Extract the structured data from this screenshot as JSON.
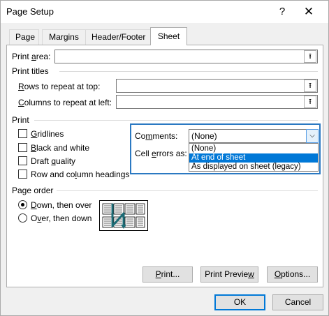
{
  "window": {
    "title": "Page Setup",
    "help_glyph": "?",
    "close_glyph": "✕"
  },
  "tabs": [
    {
      "label": "Page"
    },
    {
      "label": "Margins"
    },
    {
      "label": "Header/Footer"
    },
    {
      "label": "Sheet"
    }
  ],
  "print_area": {
    "pre": "Print ",
    "accel": "a",
    "post": "rea:",
    "value": ""
  },
  "print_titles": {
    "heading": "Print titles",
    "rows": {
      "pre": "",
      "accel": "R",
      "post": "ows to repeat at top:",
      "value": ""
    },
    "cols": {
      "pre": "",
      "accel": "C",
      "post": "olumns to repeat at left:",
      "value": ""
    }
  },
  "print_group": {
    "heading": "Print",
    "gridlines": {
      "pre": "",
      "accel": "G",
      "post": "ridlines",
      "checked": false
    },
    "black_white": {
      "pre": "",
      "accel": "B",
      "post": "lack and white",
      "checked": false
    },
    "draft": {
      "pre": "Draft ",
      "accel": "q",
      "post": "uality",
      "checked": false
    },
    "headings": {
      "pre": "Row and co",
      "accel": "l",
      "post": "umn headings",
      "checked": false
    },
    "comments": {
      "pre": "Co",
      "accel": "m",
      "post": "ments:",
      "value": "(None)"
    },
    "cell_errors": {
      "pre": "Cell ",
      "accel": "e",
      "post": "rrors as:"
    },
    "comment_options": [
      "(None)",
      "At end of sheet",
      "As displayed on sheet (legacy)"
    ],
    "selected_option_index": 1
  },
  "page_order": {
    "heading": "Page order",
    "down_over": {
      "pre": "",
      "accel": "D",
      "post": "own, then over",
      "selected": true
    },
    "over_down": {
      "pre": "O",
      "accel": "v",
      "post": "er, then down",
      "selected": false
    }
  },
  "buttons": {
    "print": {
      "pre": "",
      "accel": "P",
      "post": "rint..."
    },
    "preview": {
      "pre": "Print Previe",
      "accel": "w",
      "post": ""
    },
    "options": {
      "pre": "",
      "accel": "O",
      "post": "ptions..."
    },
    "ok": "OK",
    "cancel": "Cancel"
  },
  "icons": {
    "collapse": "⭱",
    "dropdown": "⌵"
  },
  "colors": {
    "accent": "#0078d7",
    "focus": "#2b79c2",
    "selection": "#0078d7"
  }
}
